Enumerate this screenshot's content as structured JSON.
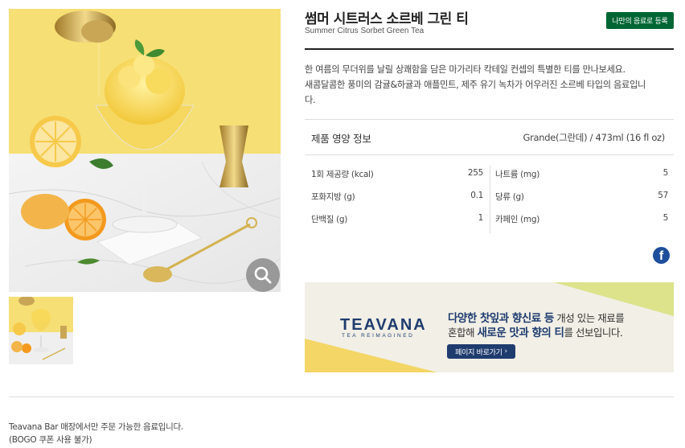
{
  "product": {
    "name_ko": "썸머 시트러스 소르베 그린 티",
    "name_en": "Summer Citrus Sorbet Green Tea",
    "register_button": "나만의 음료로 등록",
    "description_line1": "한 여름의 무더위를 날릴 상쾌함을 담은 마가리타 칵테일 컨셉의 특별한 티를 만나보세요.",
    "description_line2": "새콤달콤한 풍미의 감귤&하귤과 애플민트, 제주 유기 녹차가 어우러진 소르베 타입의 음료입니",
    "description_line3": "다."
  },
  "nutrition": {
    "heading": "제품 영양 정보",
    "size": "Grande(그란데) / 473ml (16 fl oz)",
    "rows": [
      {
        "left_label": "1회 제공량 (kcal)",
        "left_value": "255",
        "right_label": "나트륨 (mg)",
        "right_value": "5"
      },
      {
        "left_label": "포화지방 (g)",
        "left_value": "0.1",
        "right_label": "당류 (g)",
        "right_value": "57"
      },
      {
        "left_label": "단백질 (g)",
        "left_value": "1",
        "right_label": "카페인 (mg)",
        "right_value": "5"
      }
    ]
  },
  "share": {
    "facebook_glyph": "f"
  },
  "banner": {
    "logo": "TEAVANA",
    "logo_sub": "TEA REIMAGINED",
    "line1_bold": "다양한 찻잎과 향신료 등",
    "line1_rest": " 개성 있는 재료를",
    "line2_pre": "혼합해 ",
    "line2_bold": "새로운 맛과 향의 티",
    "line2_rest": "를 선보입니다.",
    "button": "페이지 바로가기"
  },
  "footer": {
    "line1": "Teavana Bar 매장에서만 주문 가능한 음료입니다.",
    "line2": "(BOGO 쿠폰 사용 불가)"
  },
  "colors": {
    "brand_green": "#006633",
    "teavana_navy": "#1f3c6f",
    "banner_yellow": "#f3d666",
    "banner_green": "#dce38a",
    "photo_yellow": "#f6df74"
  },
  "icons": {
    "zoom": "magnifier-icon",
    "share": "facebook-icon"
  }
}
